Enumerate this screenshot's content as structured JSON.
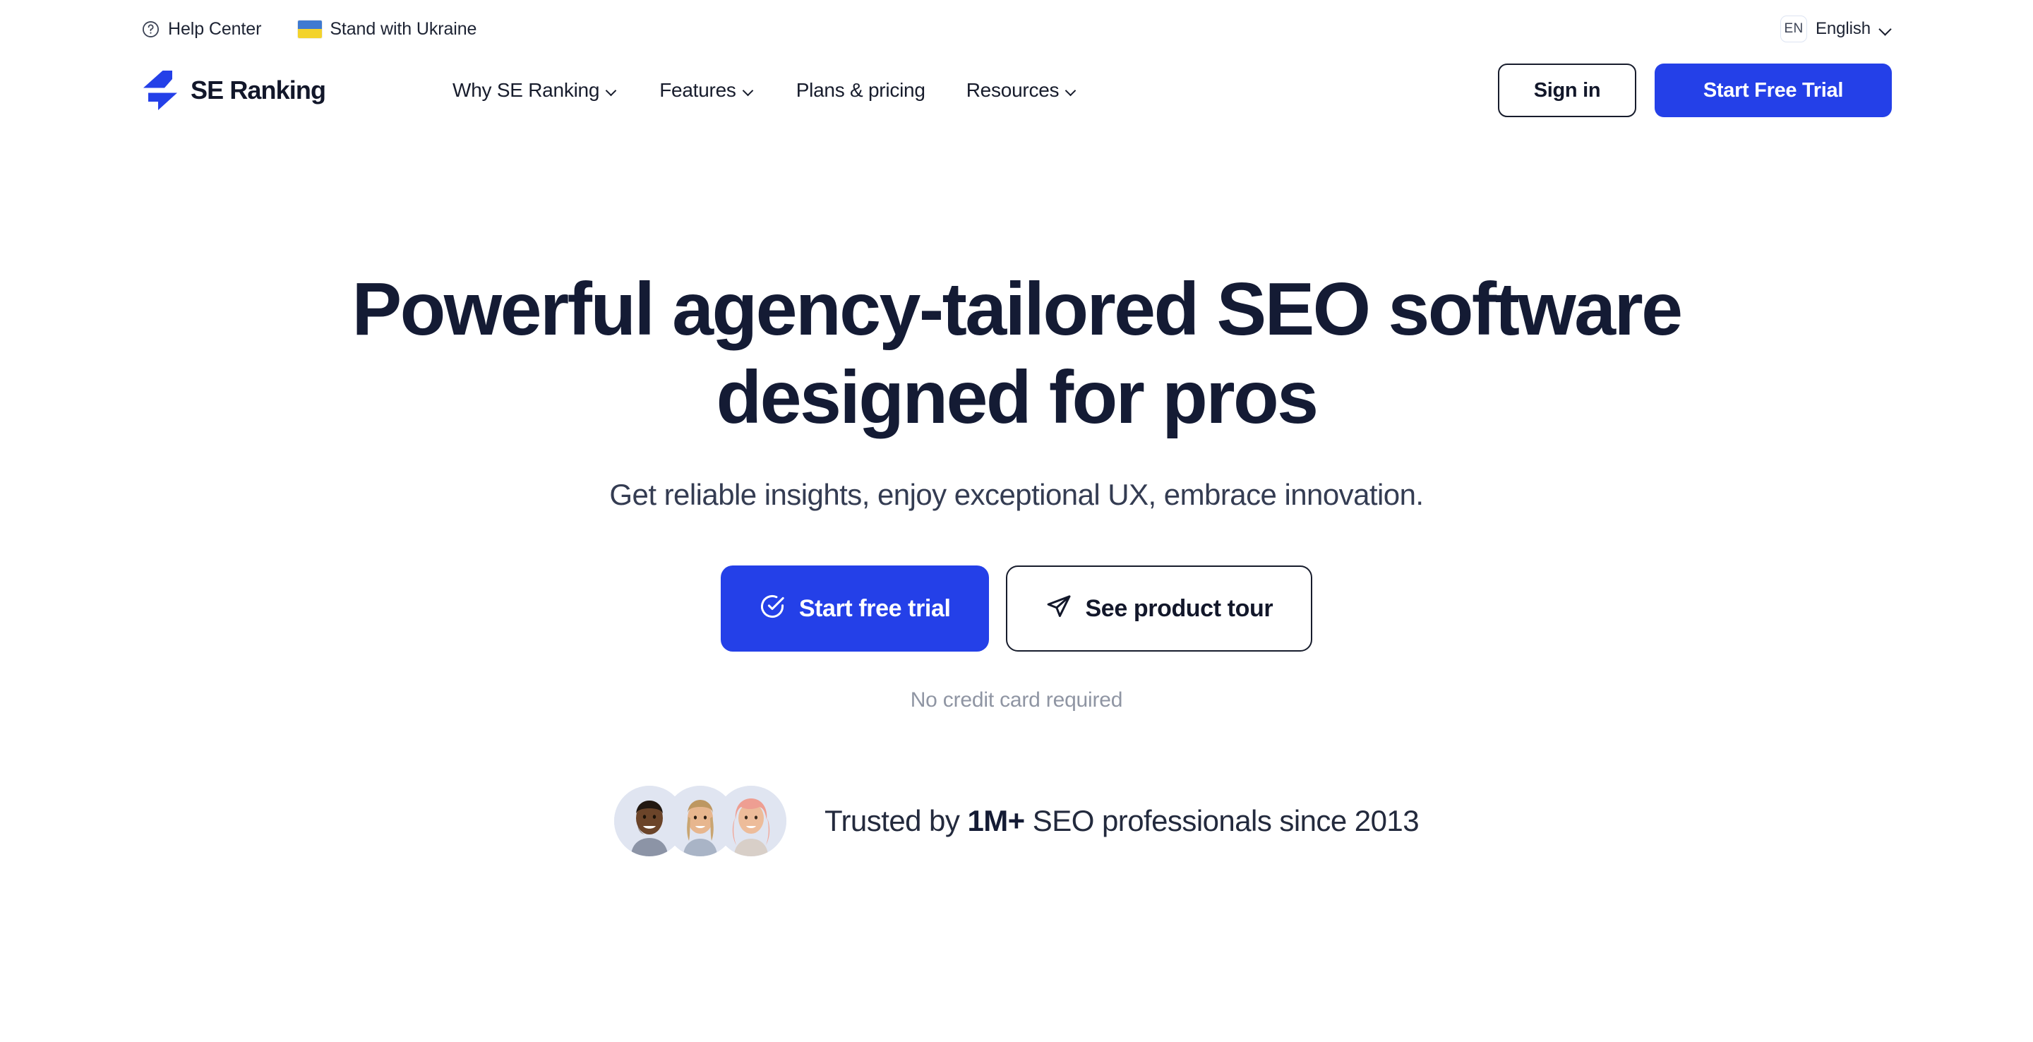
{
  "brand": {
    "name": "SE Ranking",
    "accent_color": "#2440E8",
    "text_color": "#141B34",
    "logo_icon": "se-ranking-bolt-logo"
  },
  "utility_bar": {
    "help_center": {
      "label": "Help Center",
      "icon": "help-circle-icon"
    },
    "ukraine": {
      "label": "Stand with Ukraine",
      "icon": "ukraine-flag-icon"
    },
    "language": {
      "code": "EN",
      "name": "English",
      "chevron_icon": "chevron-down-icon"
    }
  },
  "nav": {
    "items": [
      {
        "label": "Why SE Ranking",
        "has_dropdown": true
      },
      {
        "label": "Features",
        "has_dropdown": true
      },
      {
        "label": "Plans & pricing",
        "has_dropdown": false
      },
      {
        "label": "Resources",
        "has_dropdown": true
      }
    ],
    "sign_in_label": "Sign in",
    "start_trial_label": "Start Free Trial"
  },
  "hero": {
    "title": "Powerful agency-tailored SEO software designed for pros",
    "subtitle": "Get reliable insights, enjoy exceptional UX, embrace innovation.",
    "primary_cta": {
      "label": "Start free trial",
      "icon": "check-circle-icon"
    },
    "secondary_cta": {
      "label": "See product tour",
      "icon": "paper-plane-icon"
    },
    "note": "No credit card required"
  },
  "trust": {
    "avatars": [
      {
        "name": "avatar-person-1"
      },
      {
        "name": "avatar-person-2"
      },
      {
        "name": "avatar-person-3"
      }
    ],
    "prefix": "Trusted by ",
    "highlight": "1M+",
    "suffix": " SEO professionals since 2013"
  }
}
